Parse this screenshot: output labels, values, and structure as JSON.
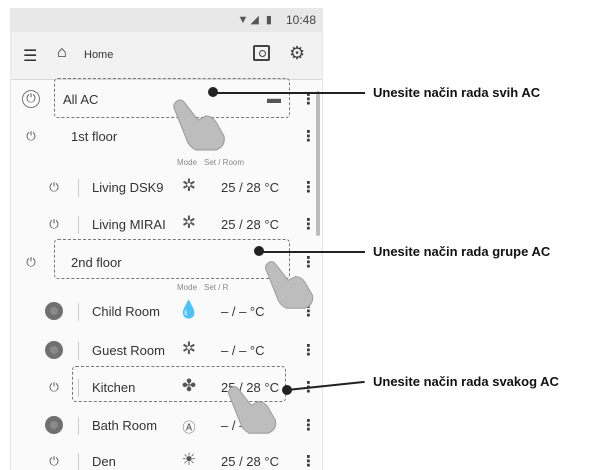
{
  "status_bar": {
    "time": "10:48",
    "icons": "▼◢ ▮"
  },
  "app_bar": {
    "title": "Home"
  },
  "headers": {
    "mode": "Mode",
    "set_room": "Set / Room",
    "set_room_cut": "Set / R"
  },
  "rows": [
    {
      "name": "All AC",
      "power": "on",
      "mode_icon": "auto-mode-icon",
      "temp": "",
      "level": 0
    },
    {
      "name": "1st floor",
      "power": "on",
      "mode_icon": "",
      "temp": "",
      "level": 0
    },
    {
      "name": "Living DSK9",
      "power": "on",
      "mode_icon": "snowflake-icon",
      "temp": "25 / 28 °C",
      "level": 1
    },
    {
      "name": "Living MIRAI",
      "power": "on",
      "mode_icon": "snowflake-icon",
      "temp": "25 / 28 °C",
      "level": 1
    },
    {
      "name": "2nd floor",
      "power": "on",
      "mode_icon": "",
      "temp": "",
      "level": 0
    },
    {
      "name": "Child Room",
      "power": "off",
      "mode_icon": "drop-icon",
      "temp": "– / –   °C",
      "level": 1
    },
    {
      "name": "Guest Room",
      "power": "off",
      "mode_icon": "snowflake-icon",
      "temp": "– / –   °C",
      "level": 1
    },
    {
      "name": "Kitchen",
      "power": "on",
      "mode_icon": "fan-icon",
      "temp": "25 / 28 °C",
      "level": 1
    },
    {
      "name": "Bath Room",
      "power": "off",
      "mode_icon": "auto-a-icon",
      "temp": "– / –   °C",
      "level": 1
    },
    {
      "name": "Den",
      "power": "on",
      "mode_icon": "sun-icon",
      "temp": "25 / 28 °C",
      "level": 1
    }
  ],
  "callouts": {
    "all": "Unesite način rada svih AC",
    "group": "Unesite način rada grupe AC",
    "each": "Unesite način rada svakog AC"
  }
}
